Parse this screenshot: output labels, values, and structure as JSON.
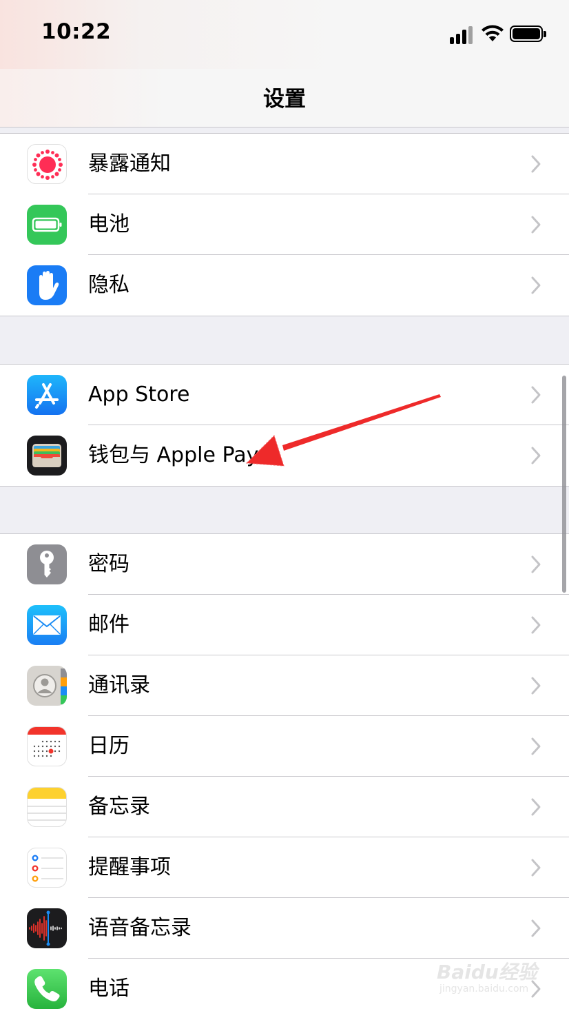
{
  "status_bar": {
    "time": "10:22"
  },
  "nav": {
    "title": "设置"
  },
  "groups": [
    {
      "items": [
        {
          "label": "暴露通知",
          "icon": "exposure-notification-icon"
        },
        {
          "label": "电池",
          "icon": "battery-icon"
        },
        {
          "label": "隐私",
          "icon": "privacy-hand-icon"
        }
      ]
    },
    {
      "items": [
        {
          "label": "App Store",
          "icon": "app-store-icon"
        },
        {
          "label": "钱包与 Apple Pay",
          "icon": "wallet-icon"
        }
      ]
    },
    {
      "items": [
        {
          "label": "密码",
          "icon": "key-icon"
        },
        {
          "label": "邮件",
          "icon": "mail-icon"
        },
        {
          "label": "通讯录",
          "icon": "contacts-icon"
        },
        {
          "label": "日历",
          "icon": "calendar-icon"
        },
        {
          "label": "备忘录",
          "icon": "notes-icon"
        },
        {
          "label": "提醒事项",
          "icon": "reminders-icon"
        },
        {
          "label": "语音备忘录",
          "icon": "voice-memos-icon"
        },
        {
          "label": "电话",
          "icon": "phone-icon"
        }
      ]
    }
  ],
  "annotation": {
    "type": "red-arrow",
    "points_to": "钱包与 Apple Pay"
  },
  "watermark": {
    "brand": "Baidu经验",
    "url": "jingyan.baidu.com"
  },
  "colors": {
    "exposure": "#ff2d55",
    "battery": "#34c759",
    "privacy": "#1a7cf5",
    "appstore": "#1d8cf8",
    "wallet": "#1c1c1e",
    "key": "#8e8e93",
    "mail": "#1f8ff7",
    "phone": "#34c759",
    "arrow": "#ee2a2a"
  }
}
